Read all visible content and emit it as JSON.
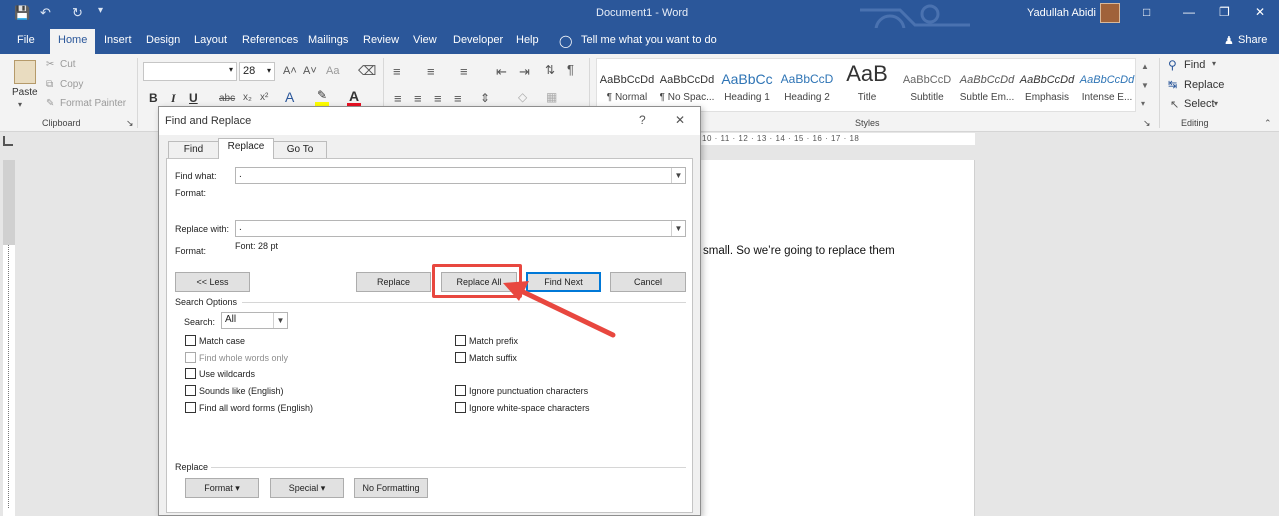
{
  "titlebar": {
    "doc_title": "Document1 - Word",
    "user_name": "Yadullah Abidi"
  },
  "tabs": [
    "File",
    "Home",
    "Insert",
    "Design",
    "Layout",
    "References",
    "Mailings",
    "Review",
    "View",
    "Developer",
    "Help"
  ],
  "tell_me": "Tell me what you want to do",
  "share": "Share",
  "clipboard": {
    "paste": "Paste",
    "cut": "Cut",
    "copy": "Copy",
    "format_painter": "Format Painter",
    "group": "Clipboard"
  },
  "font": {
    "size": "28",
    "grow": "A˄",
    "shrink": "A˅",
    "case": "Aa"
  },
  "styles": {
    "group": "Styles",
    "items": [
      {
        "sample": "AaBbCcDd",
        "name": "¶ Normal"
      },
      {
        "sample": "AaBbCcDd",
        "name": "¶ No Spac..."
      },
      {
        "sample": "AaBbCc",
        "name": "Heading 1"
      },
      {
        "sample": "AaBbCcD",
        "name": "Heading 2"
      },
      {
        "sample": "AaB",
        "name": "Title"
      },
      {
        "sample": "AaBbCcD",
        "name": "Subtitle"
      },
      {
        "sample": "AaBbCcDd",
        "name": "Subtle Em..."
      },
      {
        "sample": "AaBbCcDd",
        "name": "Emphasis"
      },
      {
        "sample": "AaBbCcDd",
        "name": "Intense E..."
      }
    ]
  },
  "editing": {
    "find": "Find",
    "replace": "Replace",
    "select": "Select",
    "group": "Editing"
  },
  "ruler": {
    "marks": "10 · 11 · 12 · 13 · 14 · 15 · 16 · 17 · 18"
  },
  "document": {
    "text": "small. So we’re going to replace them"
  },
  "dialog": {
    "title": "Find and Replace",
    "help": "?",
    "close": "✕",
    "tabs": [
      "Find",
      "Replace",
      "Go To"
    ],
    "find_label": "Find what:",
    "find_value": ".",
    "format_label": "Format:",
    "replace_label": "Replace with:",
    "replace_value": ".",
    "replace_format_label": "Format:",
    "replace_format_value": "Font: 28 pt",
    "btn_less": "<< Less",
    "btn_replace": "Replace",
    "btn_replace_all": "Replace All",
    "btn_find_next": "Find Next",
    "btn_cancel": "Cancel",
    "search_options": "Search Options",
    "search_label": "Search:",
    "search_value": "All",
    "left_options": [
      {
        "label": "Match case",
        "disabled": false
      },
      {
        "label": "Find whole words only",
        "disabled": true
      },
      {
        "label": "Use wildcards",
        "disabled": false
      },
      {
        "label": "Sounds like (English)",
        "disabled": false
      },
      {
        "label": "Find all word forms (English)",
        "disabled": false
      }
    ],
    "right_options": [
      "Match prefix",
      "Match suffix",
      "Ignore punctuation characters",
      "Ignore white-space characters"
    ],
    "replace_section": "Replace",
    "btn_format": "Format ▾",
    "btn_special": "Special ▾",
    "btn_no_formatting": "No Formatting"
  },
  "colors": {
    "accent": "#2b579a",
    "highlight_box": "#e8473f",
    "focus_blue": "#0078d7"
  }
}
